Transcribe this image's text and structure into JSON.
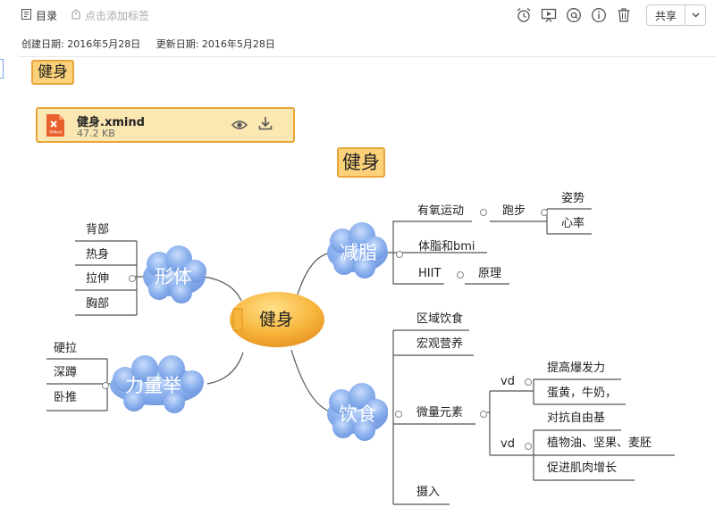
{
  "toolbar": {
    "toc_label": "目录",
    "tag_placeholder": "点击添加标签",
    "share_label": "共享",
    "icons": [
      "outline-icon",
      "tag-icon",
      "alarm-icon",
      "present-icon",
      "at-icon",
      "info-icon",
      "trash-icon",
      "chevron-down-icon"
    ]
  },
  "dates": {
    "created": "创建日期: 2016年5月28日",
    "updated": "更新日期: 2016年5月28日"
  },
  "note_title": "健身",
  "attachment": {
    "filename": "健身.xmind",
    "size": "47.2 KB",
    "file_badge": "XMind"
  },
  "mindmap": {
    "title": "健身",
    "central": "健身",
    "branches": {
      "fat_loss": {
        "label": "减脂",
        "aerobic": "有氧运动",
        "running": "跑步",
        "posture": "姿势",
        "heart_rate": "心率",
        "bmi": "体脂和bmi",
        "hiit": "HIIT",
        "principle": "原理"
      },
      "shape": {
        "label": "形体",
        "items": [
          "背部",
          "热身",
          "拉伸",
          "胸部"
        ]
      },
      "strength": {
        "label": "力量举",
        "items": [
          "硬拉",
          "深蹲",
          "卧推"
        ]
      },
      "diet": {
        "label": "饮食",
        "regional": "区域饮食",
        "macro": "宏观营养",
        "micro": "微量元素",
        "vd1": "vd",
        "explosive": "提高爆发力",
        "yolk": "蛋黄，牛奶，",
        "free_radical": "对抗自由基",
        "vd2": "vd",
        "oils": "植物油、坚果、麦胚",
        "muscle": "促进肌肉增长",
        "intake": "摄入"
      }
    }
  },
  "colors": {
    "accent_orange": "#e8a53a",
    "chip_fill": "#fbd27a",
    "cloud_blue": "#7fa7ea",
    "line_gray": "#555555"
  }
}
